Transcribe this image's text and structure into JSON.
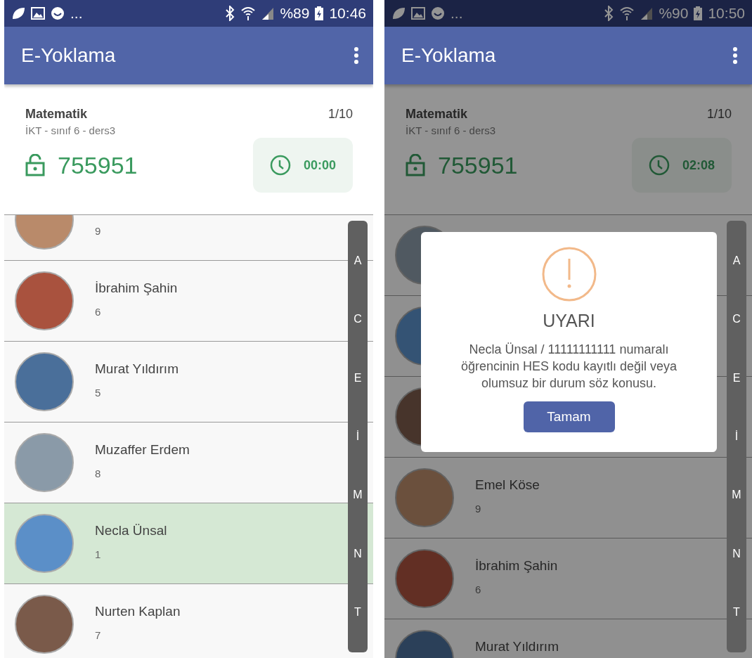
{
  "screens": [
    {
      "status_bar": {
        "more": "...",
        "battery": "%89",
        "time": "10:46"
      },
      "app_bar": {
        "title": "E-Yoklama"
      },
      "course": {
        "name": "Matematik",
        "count": "1/10",
        "subtitle": "İKT - sınıf 6 - ders3",
        "code": "755951",
        "timer": "00:00"
      },
      "students": [
        {
          "number": "9",
          "selected": false
        },
        {
          "name": "İbrahim Şahin",
          "number": "6",
          "selected": false
        },
        {
          "name": "Murat Yıldırım",
          "number": "5",
          "selected": false
        },
        {
          "name": "Muzaffer Erdem",
          "number": "8",
          "selected": false
        },
        {
          "name": "Necla Ünsal",
          "number": "1",
          "selected": true
        },
        {
          "name": "Nurten Kaplan",
          "number": "7",
          "selected": false
        }
      ],
      "index_letters": [
        "A",
        "C",
        "E",
        "İ",
        "M",
        "N",
        "T"
      ]
    },
    {
      "status_bar": {
        "more": "...",
        "battery": "%90",
        "time": "10:50"
      },
      "app_bar": {
        "title": "E-Yoklama"
      },
      "course": {
        "name": "Matematik",
        "count": "1/10",
        "subtitle": "İKT - sınıf 6 - ders3",
        "code": "755951",
        "timer": "02:08"
      },
      "students": [
        {
          "selected": false
        },
        {
          "selected": false
        },
        {
          "selected": false
        },
        {
          "name": "Emel Köse",
          "number": "9",
          "selected": false
        },
        {
          "name": "İbrahim Şahin",
          "number": "6",
          "selected": false
        },
        {
          "name": "Murat Yıldırım",
          "selected": false
        }
      ],
      "index_letters": [
        "A",
        "C",
        "E",
        "İ",
        "M",
        "N",
        "T"
      ],
      "dialog": {
        "title": "UYARI",
        "message": "Necla Ünsal / 11111111111 numaralı öğrencinin HES kodu kayıtlı değil veya olumsuz bir durum söz konusu.",
        "button": "Tamam"
      }
    }
  ]
}
